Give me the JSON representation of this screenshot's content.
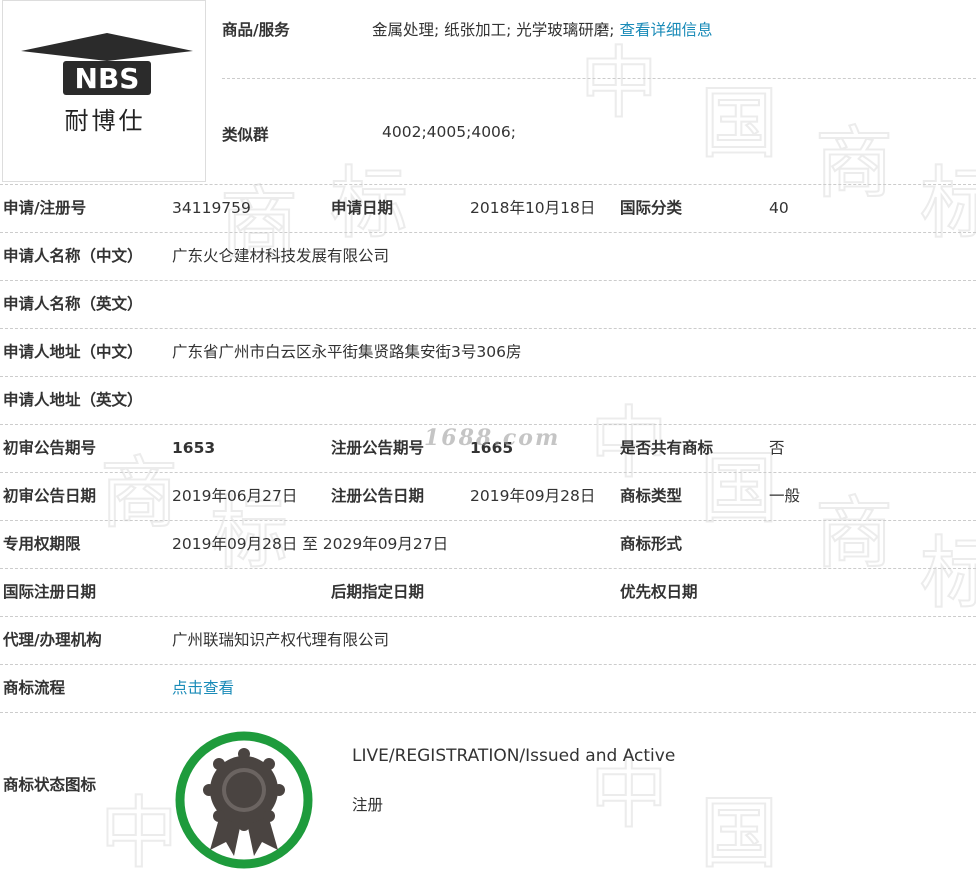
{
  "logo": {
    "brand_letters": "NBS",
    "brand_cn": "耐博仕"
  },
  "goods": {
    "label": "商品/服务",
    "text": "金属处理; 纸张加工; 光学玻璃研磨; ",
    "link": "查看详细信息"
  },
  "similar": {
    "label": "类似群",
    "value": "4002;4005;4006;"
  },
  "rows": {
    "r1": {
      "l1": "申请/注册号",
      "v1": "34119759",
      "l2": "申请日期",
      "v2": "2018年10月18日",
      "l3": "国际分类",
      "v3": "40"
    },
    "r2": {
      "l1": "申请人名称（中文）",
      "v1": "广东火仑建材科技发展有限公司"
    },
    "r3": {
      "l1": "申请人名称（英文）",
      "v1": ""
    },
    "r4": {
      "l1": "申请人地址（中文）",
      "v1": "广东省广州市白云区永平街集贤路集安街3号306房"
    },
    "r5": {
      "l1": "申请人地址（英文）",
      "v1": ""
    },
    "r6": {
      "l1": "初审公告期号",
      "v1": "1653",
      "l2": "注册公告期号",
      "v2": "1665",
      "l3": "是否共有商标",
      "v3": "否"
    },
    "r7": {
      "l1": "初审公告日期",
      "v1": "2019年06月27日",
      "l2": "注册公告日期",
      "v2": "2019年09月28日",
      "l3": "商标类型",
      "v3": "一般"
    },
    "r8": {
      "l1": "专用权期限",
      "v1": "2019年09月28日 至 2029年09月27日",
      "l3": "商标形式",
      "v3": ""
    },
    "r9": {
      "l1": "国际注册日期",
      "v1": "",
      "l2": "后期指定日期",
      "v2": "",
      "l3": "优先权日期",
      "v3": ""
    },
    "r10": {
      "l1": "代理/办理机构",
      "v1": "广州联瑞知识产权代理有限公司"
    },
    "r11": {
      "l1": "商标流程",
      "v1": "点击查看"
    }
  },
  "status": {
    "label": "商标状态图标",
    "en": "LIVE/REGISTRATION/Issued and Active",
    "cn": "注册"
  },
  "watermark": {
    "site": "1688.com",
    "chars": [
      "中",
      "国",
      "商",
      "标"
    ]
  },
  "colors": {
    "link": "#1a8bb8",
    "badge_ring": "#1e9b3c",
    "badge_dark": "#4a4441",
    "divider": "#cccccc"
  }
}
